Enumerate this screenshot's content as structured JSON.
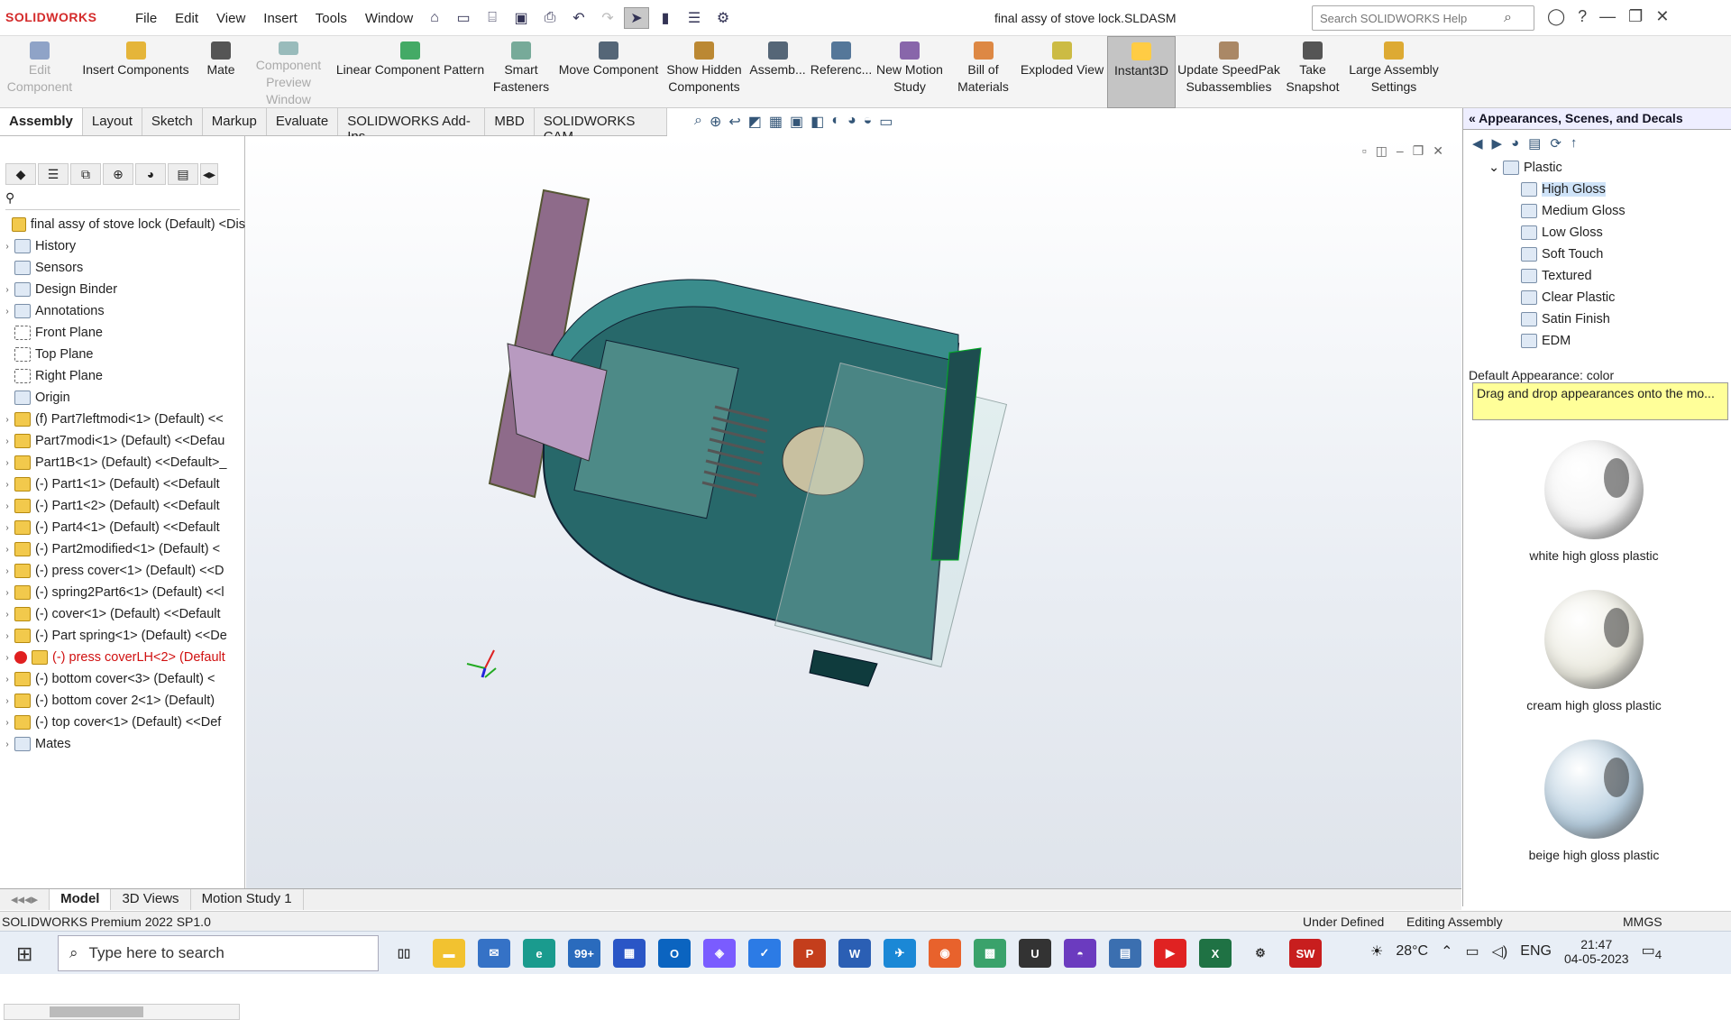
{
  "app": {
    "logo": "SOLIDWORKS",
    "menu": [
      "File",
      "Edit",
      "View",
      "Insert",
      "Tools",
      "Window"
    ],
    "doc_title": "final assy of stove lock.SLDASM",
    "search_placeholder": "Search SOLIDWORKS Help"
  },
  "ribbon": [
    {
      "label": "Edit\nComponent",
      "disabled": true
    },
    {
      "label": "Insert Components"
    },
    {
      "label": "Mate"
    },
    {
      "label": "Component\nPreview Window",
      "disabled": true
    },
    {
      "label": "Linear Component Pattern"
    },
    {
      "label": "Smart\nFasteners"
    },
    {
      "label": "Move Component"
    },
    {
      "label": "Show Hidden\nComponents"
    },
    {
      "label": "Assemb..."
    },
    {
      "label": "Referenc..."
    },
    {
      "label": "New Motion\nStudy"
    },
    {
      "label": "Bill of\nMaterials"
    },
    {
      "label": "Exploded View"
    },
    {
      "label": "Instant3D",
      "active": true
    },
    {
      "label": "Update SpeedPak\nSubassemblies"
    },
    {
      "label": "Take\nSnapshot"
    },
    {
      "label": "Large Assembly\nSettings"
    }
  ],
  "tabs": [
    "Assembly",
    "Layout",
    "Sketch",
    "Markup",
    "Evaluate",
    "SOLIDWORKS Add-Ins",
    "MBD",
    "SOLIDWORKS CAM"
  ],
  "tree": [
    {
      "label": "final assy of stove lock  (Default) <Dis",
      "icon": "part",
      "arrow": ""
    },
    {
      "label": "History",
      "icon": "folder",
      "arrow": "›"
    },
    {
      "label": "Sensors",
      "icon": "folder",
      "arrow": ""
    },
    {
      "label": "Design Binder",
      "icon": "folder",
      "arrow": "›"
    },
    {
      "label": "Annotations",
      "icon": "folder",
      "arrow": "›"
    },
    {
      "label": "Front Plane",
      "icon": "plane",
      "arrow": ""
    },
    {
      "label": "Top Plane",
      "icon": "plane",
      "arrow": ""
    },
    {
      "label": "Right Plane",
      "icon": "plane",
      "arrow": ""
    },
    {
      "label": "Origin",
      "icon": "origin",
      "arrow": ""
    },
    {
      "label": "(f) Part7leftmodi<1> (Default) <<",
      "icon": "part",
      "arrow": "›"
    },
    {
      "label": "Part7modi<1> (Default) <<Defau",
      "icon": "part",
      "arrow": "›"
    },
    {
      "label": "Part1B<1> (Default) <<Default>_",
      "icon": "part",
      "arrow": "›"
    },
    {
      "label": "(-) Part1<1> (Default) <<Default",
      "icon": "part",
      "arrow": "›"
    },
    {
      "label": "(-) Part1<2> (Default) <<Default",
      "icon": "part",
      "arrow": "›"
    },
    {
      "label": "(-) Part4<1> (Default) <<Default",
      "icon": "part",
      "arrow": "›"
    },
    {
      "label": "(-) Part2modified<1> (Default) <",
      "icon": "part",
      "arrow": "›"
    },
    {
      "label": "(-) press cover<1> (Default) <<D",
      "icon": "part",
      "arrow": "›"
    },
    {
      "label": "(-) spring2Part6<1> (Default) <<l",
      "icon": "part",
      "arrow": "›"
    },
    {
      "label": "(-) cover<1> (Default) <<Default",
      "icon": "part",
      "arrow": "›"
    },
    {
      "label": "(-) Part spring<1> (Default) <<De",
      "icon": "part",
      "arrow": "›"
    },
    {
      "label": "(-) press coverLH<2> (Default",
      "icon": "part",
      "arrow": "›",
      "error": true
    },
    {
      "label": "(-) bottom cover<3> (Default) <",
      "icon": "part",
      "arrow": "›"
    },
    {
      "label": "(-) bottom cover 2<1> (Default) ",
      "icon": "part",
      "arrow": "›"
    },
    {
      "label": "(-) top cover<1> (Default) <<Def",
      "icon": "part",
      "arrow": "›"
    },
    {
      "label": "Mates",
      "icon": "mates",
      "arrow": "›"
    }
  ],
  "right_panel": {
    "title": "Appearances, Scenes, and Decals",
    "folder": "Plastic",
    "items": [
      "High Gloss",
      "Medium Gloss",
      "Low Gloss",
      "Soft Touch",
      "Textured",
      "Clear Plastic",
      "Satin Finish",
      "EDM"
    ],
    "selected": "High Gloss",
    "default_label": "Default Appearance: color",
    "tip": "Drag and drop appearances onto the mo...",
    "swatches": [
      {
        "name": "white high gloss plastic",
        "color": "#f4f4f4"
      },
      {
        "name": "cream high gloss plastic",
        "color": "#ecebe0"
      },
      {
        "name": "beige high gloss plastic",
        "color": "#b8cfe0"
      }
    ]
  },
  "bottom_tabs": [
    "Model",
    "3D Views",
    "Motion Study 1"
  ],
  "status": {
    "left": "SOLIDWORKS Premium 2022 SP1.0",
    "def": "Under Defined",
    "mode": "Editing Assembly",
    "units": "MMGS"
  },
  "taskbar": {
    "search": "Type here to search",
    "temp": "28°C",
    "lang": "ENG",
    "time": "21:47",
    "date": "04-05-2023",
    "badge": "99+",
    "notif": "4"
  }
}
